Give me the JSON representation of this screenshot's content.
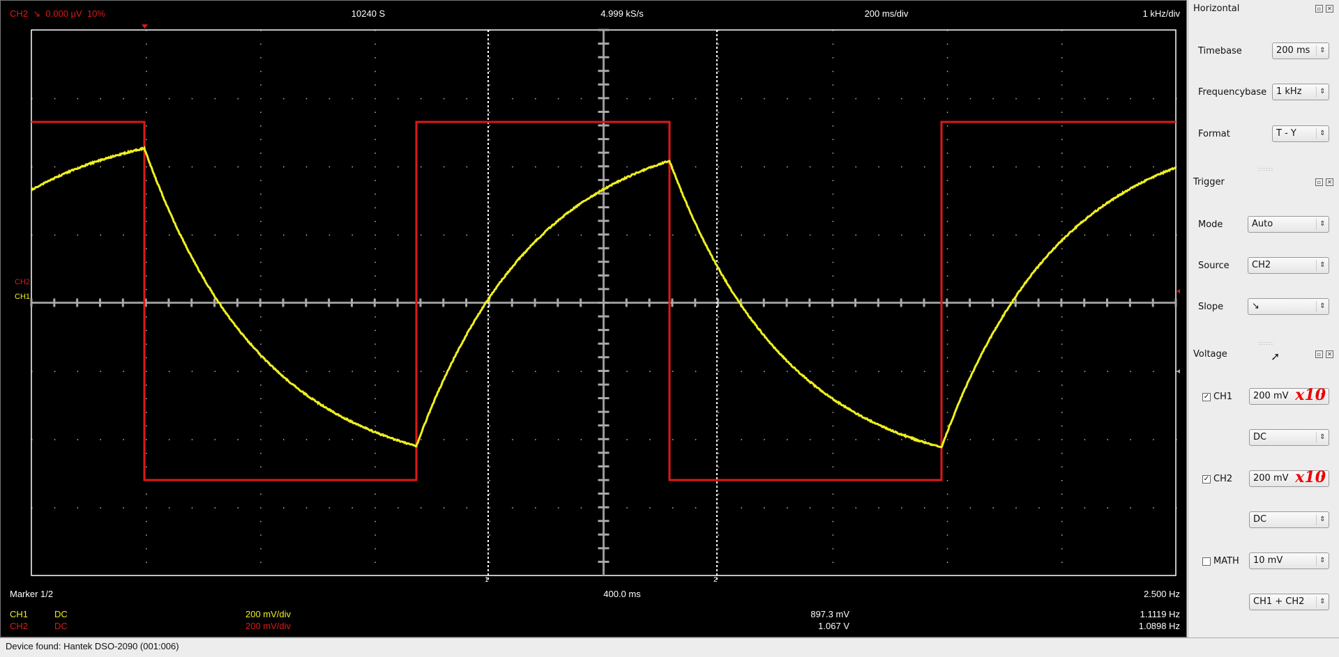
{
  "top": {
    "trigger_channel": "CH2",
    "trigger_slope": "↘",
    "trigger_level": "0.000 µV",
    "pretrigger": "10%",
    "samples": "10240 S",
    "samplerate": "4.999 kS/s",
    "timebase": "200 ms/div",
    "freqbase": "1 kHz/div"
  },
  "scope": {
    "ch1_label": "CH1",
    "ch2_label": "CH2",
    "marker1": "1",
    "marker2": "2",
    "colors": {
      "ch1": "#f0f020",
      "ch2": "#e01818",
      "grid": "#ffffff"
    }
  },
  "bottom": {
    "marker_label": "Marker 1/2",
    "marker_dt": "400.0 ms",
    "marker_freq": "2.500 Hz",
    "rows": [
      {
        "channel": "CH1",
        "coupling": "DC",
        "scale": "200 mV/div",
        "amplitude": "897.3 mV",
        "frequency": "1.1119 Hz"
      },
      {
        "channel": "CH2",
        "coupling": "DC",
        "scale": "200 mV/div",
        "amplitude": "1.067 V",
        "frequency": "1.0898 Hz"
      }
    ]
  },
  "status": "Device found: Hantek DSO-2090 (001:006)",
  "panel": {
    "horizontal": {
      "title": "Horizontal",
      "timebase_label": "Timebase",
      "timebase": "200 ms",
      "frequencybase_label": "Frequencybase",
      "frequencybase": "1 kHz",
      "format_label": "Format",
      "format": "T - Y"
    },
    "trigger": {
      "title": "Trigger",
      "mode_label": "Mode",
      "mode": "Auto",
      "source_label": "Source",
      "source": "CH2",
      "slope_label": "Slope",
      "slope": "↘"
    },
    "voltage": {
      "title": "Voltage",
      "ch1_label": "CH1",
      "ch1_enabled": true,
      "ch1_gain": "200 mV",
      "ch1_probe": "x10",
      "ch1_coupling": "DC",
      "ch2_label": "CH2",
      "ch2_enabled": true,
      "ch2_gain": "200 mV",
      "ch2_probe": "x10",
      "ch2_coupling": "DC",
      "math_label": "MATH",
      "math_enabled": false,
      "math_gain": "10 mV",
      "math_mode": "CH1 + CH2"
    }
  }
}
